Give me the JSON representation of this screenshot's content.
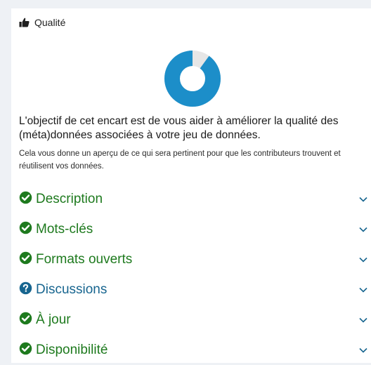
{
  "panel": {
    "title": "Qualité",
    "icon": "thumbs-up-icon",
    "score_fraction": 0.9,
    "donut_color": "#1c8ec9",
    "donut_track_color": "#e6e6e6"
  },
  "intro": "L'objectif de cet encart est de vous aider à améliorer la qualité des (méta)données associées à votre jeu de données.",
  "hint": "Cela vous donne un aperçu de ce qui sera pertinent pour que les contributeurs trouvent et réutilisent vos données.",
  "criteria": [
    {
      "label": "Description",
      "status": "ok",
      "icon": "check-circle-icon"
    },
    {
      "label": "Mots-clés",
      "status": "ok",
      "icon": "check-circle-icon"
    },
    {
      "label": "Formats ouverts",
      "status": "ok",
      "icon": "check-circle-icon"
    },
    {
      "label": "Discussions",
      "status": "info",
      "icon": "question-circle-icon"
    },
    {
      "label": "À jour",
      "status": "ok",
      "icon": "check-circle-icon"
    },
    {
      "label": "Disponibilité",
      "status": "ok",
      "icon": "check-circle-icon"
    }
  ],
  "colors": {
    "ok": "#1e7a1e",
    "info": "#17658f"
  }
}
